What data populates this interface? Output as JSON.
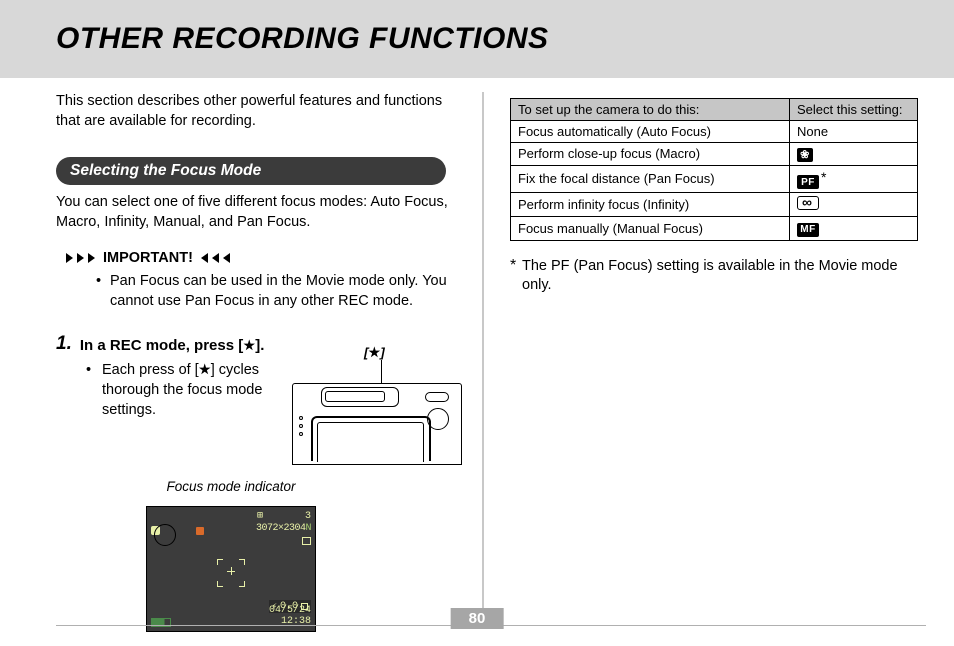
{
  "page_number": "80",
  "title": "OTHER RECORDING FUNCTIONS",
  "intro": "This section describes other powerful features and functions that are available for recording.",
  "section": {
    "heading": "Selecting the Focus Mode",
    "description": "You can select one of five different focus modes: Auto Focus, Macro, Infinity, Manual, and Pan Focus.",
    "important_label": "IMPORTANT!",
    "important_text": "Pan Focus can be used in the Movie mode only. You cannot use Pan Focus in any other REC mode."
  },
  "step": {
    "number": "1.",
    "text_before": "In a REC mode, press [",
    "text_after": "].",
    "sub_before": "Each press of [",
    "sub_after": "] cycles thorough the focus mode settings.",
    "pointer_label_before": "[",
    "pointer_label_after": "]",
    "focus_indicator_label": "Focus mode indicator"
  },
  "lcd": {
    "count": "3",
    "resolution": "3072×2304",
    "quality": "N",
    "ev_value": "0.0",
    "date": "04/5/24",
    "time": "12:38"
  },
  "table": {
    "header1": "To set up the camera to do this:",
    "header2": "Select this setting:",
    "rows": [
      {
        "label": "Focus automatically (Auto Focus)",
        "setting_text": "None",
        "icon": "none"
      },
      {
        "label": "Perform close-up focus (Macro)",
        "setting_text": "",
        "icon": "macro"
      },
      {
        "label": "Fix the focal distance (Pan Focus)",
        "setting_text": "",
        "icon": "pf",
        "note": "*"
      },
      {
        "label": "Perform infinity focus (Infinity)",
        "setting_text": "",
        "icon": "infinity"
      },
      {
        "label": "Focus manually (Manual Focus)",
        "setting_text": "",
        "icon": "mf"
      }
    ]
  },
  "icons": {
    "pf": "PF",
    "mf": "MF",
    "macro": "❀"
  },
  "footnote": "The PF (Pan Focus) setting is available in the Movie mode only."
}
